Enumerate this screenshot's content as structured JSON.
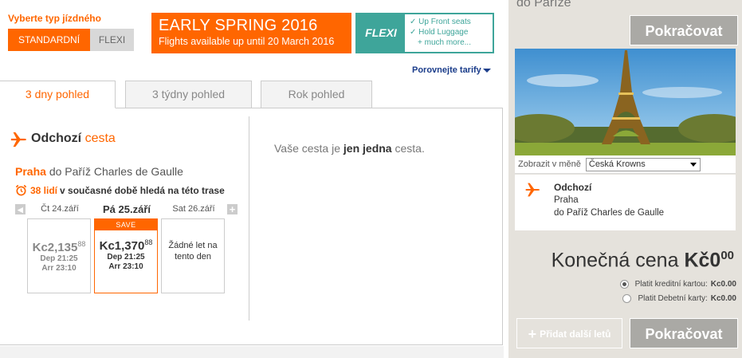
{
  "fare": {
    "label": "Vyberte typ jízdného",
    "options": [
      "STANDARDNÍ",
      "FLEXI"
    ],
    "selected": "STANDARDNÍ"
  },
  "promo": {
    "title": "EARLY SPRING 2016",
    "subtitle": "Flights available up until 20 March 2016"
  },
  "flexi_banner": {
    "name": "FLEXI",
    "items": [
      "✓ Up Front seats",
      "✓ Hold Luggage",
      "+ much more..."
    ]
  },
  "compare_link": "Porovnejte tarify",
  "tabs": [
    {
      "label": "3 dny pohled",
      "active": true
    },
    {
      "label": "3 týdny pohled",
      "active": false
    },
    {
      "label": "Rok pohled",
      "active": false
    }
  ],
  "outbound": {
    "title": "Odchozí",
    "title_accent": "cesta",
    "from": "Praha",
    "to_text": "do Paříž Charles de Gaulle",
    "watchers_num": "38 lidí",
    "watchers_text": "v současné době hledá na této trase"
  },
  "days": [
    {
      "label": "Čt 24.září",
      "price": "Kc2,135",
      "cents": "88",
      "dep": "Dep 21:25",
      "arr": "Arr 23:10"
    },
    {
      "label": "Pá 25.září",
      "save": "SAVE",
      "price": "Kc1,370",
      "cents": "88",
      "dep": "Dep 21:25",
      "arr": "Arr 23:10"
    },
    {
      "label": "Sat 26.září",
      "no_flight": "Žádné let na tento den"
    }
  ],
  "one_way": {
    "pre": "Vaše cesta je",
    "bold": "jen jedna",
    "post": "cesta."
  },
  "sidebar": {
    "title": "do Paříže",
    "continue": "Pokračovat",
    "currency_label": "Zobrazit v měně",
    "currency_value": "Česká Krowns",
    "summary_title": "Odchozí",
    "summary_from": "Praha",
    "summary_to": "do Paříž Charles de Gaulle",
    "final_label": "Konečná cena",
    "final_value": "Kč0",
    "final_cents": "00",
    "pay_credit": "Platit kreditní kartou:",
    "pay_credit_amt": "Kc0.00",
    "pay_debit": "Platit Debetní karty:",
    "pay_debit_amt": "Kc0.00",
    "add_flight": "Přidat další letů"
  }
}
